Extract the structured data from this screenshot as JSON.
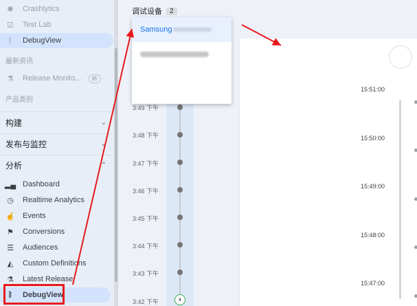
{
  "sidebar": {
    "crashlytics": "Crashlytics",
    "testlab": "Test Lab",
    "debugview_top": "DebugView",
    "section_latest": "最新资讯",
    "release_monitor": "Release Monito...",
    "release_badge": "新",
    "section_products": "产品类别",
    "group_build": "构建",
    "group_release": "发布与监控",
    "group_analytics": "分析",
    "dashboard": "Dashboard",
    "realtime": "Realtime Analytics",
    "events": "Events",
    "conversions": "Conversions",
    "audiences": "Audiences",
    "custom_defs": "Custom Definitions",
    "latest_release": "Latest Release",
    "debugview": "DebugView"
  },
  "header": {
    "label": "调试设备",
    "count": "2"
  },
  "dropdown": {
    "options": [
      "Samsung",
      ""
    ]
  },
  "timeline": {
    "labels": [
      "3:49 下午",
      "3:48 下午",
      "3:47 下午",
      "3:46 下午",
      "3:45 下午",
      "3:44 下午",
      "3:43 下午",
      "3:42 下午"
    ],
    "last_count": "4"
  },
  "right": {
    "times": [
      "15:51:00",
      "15:50:00",
      "15:49:00",
      "15:48:00",
      "15:47:00"
    ]
  },
  "colors": {
    "accent": "#1a73e8",
    "annotation": "#e8191c",
    "selected": "#d3e3fd"
  }
}
